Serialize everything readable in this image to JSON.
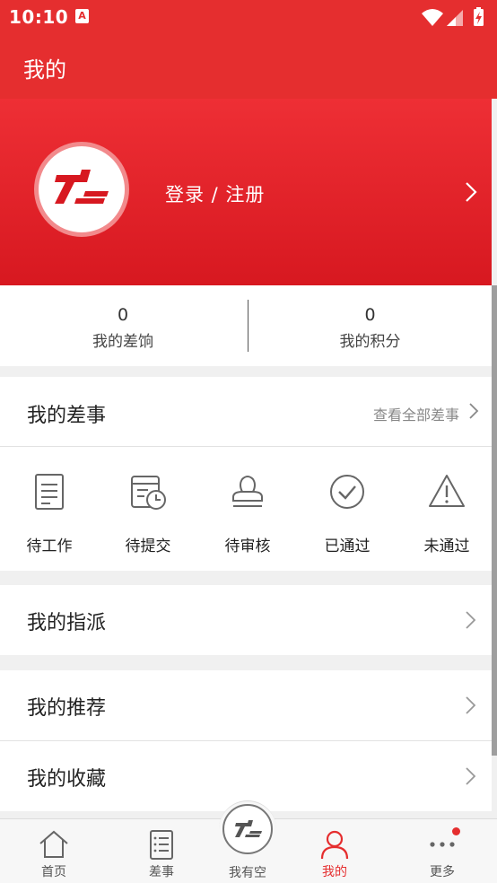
{
  "status_bar": {
    "time": "10:10",
    "notification_glyph": "A",
    "icons": [
      "wifi-icon",
      "signal-icon",
      "battery-charging-icon"
    ]
  },
  "header": {
    "title": "我的"
  },
  "profile": {
    "login_label": "登录 / 注册",
    "avatar_icon": "app-logo-icon"
  },
  "stats": [
    {
      "value": "0",
      "label": "我的差饷"
    },
    {
      "value": "0",
      "label": "我的积分"
    }
  ],
  "errands": {
    "title": "我的差事",
    "view_all": "查看全部差事",
    "statuses": [
      {
        "label": "待工作",
        "icon": "document-icon"
      },
      {
        "label": "待提交",
        "icon": "calendar-clock-icon"
      },
      {
        "label": "待审核",
        "icon": "stamp-icon"
      },
      {
        "label": "已通过",
        "icon": "check-circle-icon"
      },
      {
        "label": "未通过",
        "icon": "warning-icon"
      }
    ]
  },
  "menu": {
    "assignments": "我的指派",
    "recommendations": "我的推荐",
    "favorites": "我的收藏"
  },
  "tab_bar": {
    "tabs": [
      {
        "label": "首页",
        "icon": "home-icon"
      },
      {
        "label": "差事",
        "icon": "list-icon"
      },
      {
        "label": "我有空",
        "icon": "app-logo-icon"
      },
      {
        "label": "我的",
        "icon": "user-icon"
      },
      {
        "label": "更多",
        "icon": "more-icon"
      }
    ],
    "active": "我的"
  },
  "colors": {
    "brand_red": "#e52e2f",
    "banner_top": "#ee2f35",
    "banner_bottom": "#d71820"
  }
}
